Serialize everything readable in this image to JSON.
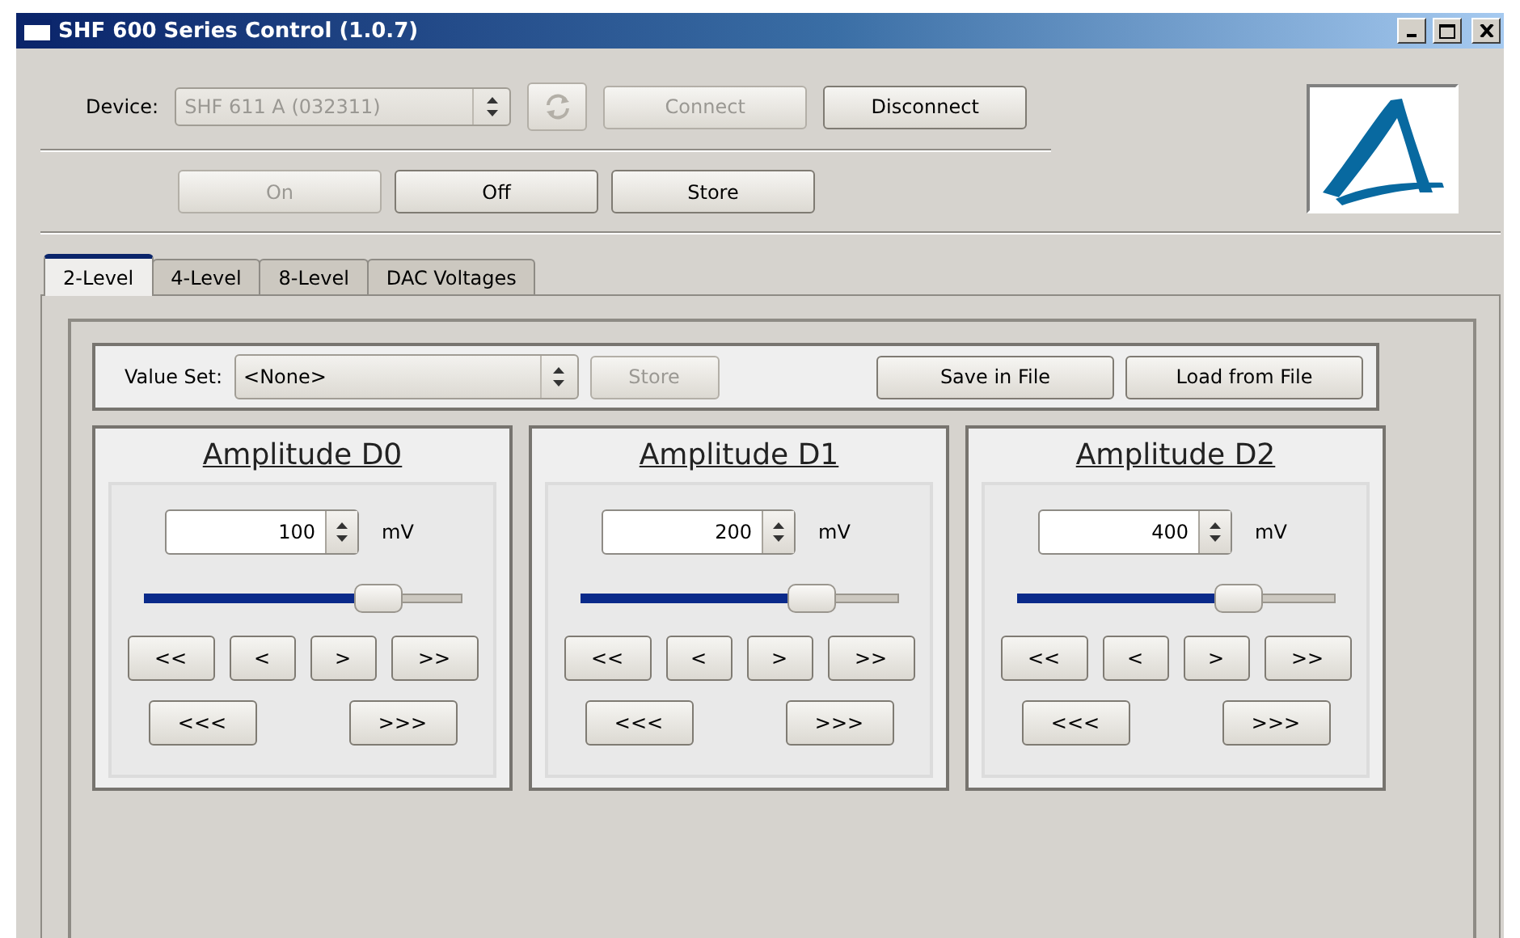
{
  "window": {
    "title": "SHF 600 Series Control (1.0.7)"
  },
  "device": {
    "label": "Device:",
    "value": "SHF 611 A (032311)",
    "disabled": true
  },
  "device_buttons": [
    {
      "kind": "refresh",
      "disabled": true
    },
    {
      "kind": "text",
      "label": "Connect",
      "disabled": true
    },
    {
      "kind": "text",
      "label": "Disconnect",
      "disabled": false
    }
  ],
  "power_buttons": [
    {
      "label": "On",
      "disabled": true
    },
    {
      "label": "Off",
      "disabled": false
    },
    {
      "label": "Store",
      "disabled": false
    }
  ],
  "tabs": [
    {
      "label": "2-Level",
      "selected": true
    },
    {
      "label": "4-Level",
      "selected": false
    },
    {
      "label": "8-Level",
      "selected": false
    },
    {
      "label": "DAC Voltages",
      "selected": false
    }
  ],
  "value_set": {
    "label": "Value Set:",
    "value": "<None>",
    "store": {
      "label": "Store",
      "disabled": true
    },
    "buttons": [
      "Save in File",
      "Load from File"
    ]
  },
  "amplitudes": [
    {
      "title": "Amplitude D0",
      "value": "100",
      "unit": "mV",
      "level": 0.74,
      "steps": [
        "<<",
        "<",
        ">",
        ">>"
      ],
      "jumps": [
        "<<<",
        ">>>"
      ]
    },
    {
      "title": "Amplitude D1",
      "value": "200",
      "unit": "mV",
      "level": 0.73,
      "steps": [
        "<<",
        "<",
        ">",
        ">>"
      ],
      "jumps": [
        "<<<",
        ">>>"
      ]
    },
    {
      "title": "Amplitude D2",
      "value": "400",
      "unit": "mV",
      "level": 0.7,
      "steps": [
        "<<",
        "<",
        ">",
        ">>"
      ],
      "jumps": [
        "<<<",
        ">>>"
      ]
    }
  ]
}
